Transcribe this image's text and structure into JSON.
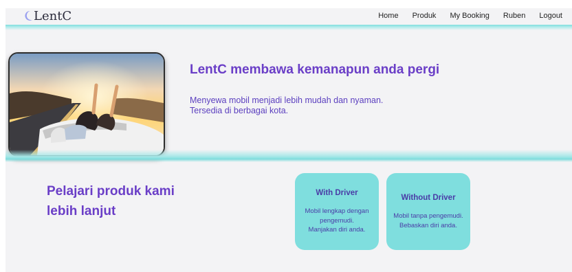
{
  "brand": {
    "name": "LentC",
    "moon_color": "#9aa0f0"
  },
  "nav": {
    "items": [
      "Home",
      "Produk",
      "My Booking",
      "Ruben",
      "Logout"
    ]
  },
  "hero": {
    "title": "LentC membawa kemanapun anda pergi",
    "subtitle_lines": [
      "Menyewa mobil menjadi lebih mudah dan nyaman.",
      "Tersedia di berbagai kota."
    ]
  },
  "products": {
    "heading_lines": [
      "Pelajari produk kami",
      "lebih lanjut"
    ],
    "cards": [
      {
        "title": "With Driver",
        "desc_lines": [
          "Mobil lengkap dengan",
          "pengemudi.",
          "Manjakan diri anda."
        ]
      },
      {
        "title": "Without Driver",
        "desc_lines": [
          "Mobil tanpa pengemudi.",
          "Bebaskan diri anda."
        ]
      }
    ]
  },
  "colors": {
    "accent_purple": "#6a3ec7",
    "accent_cyan": "#7fdede",
    "card_text": "#4a3ca6"
  }
}
